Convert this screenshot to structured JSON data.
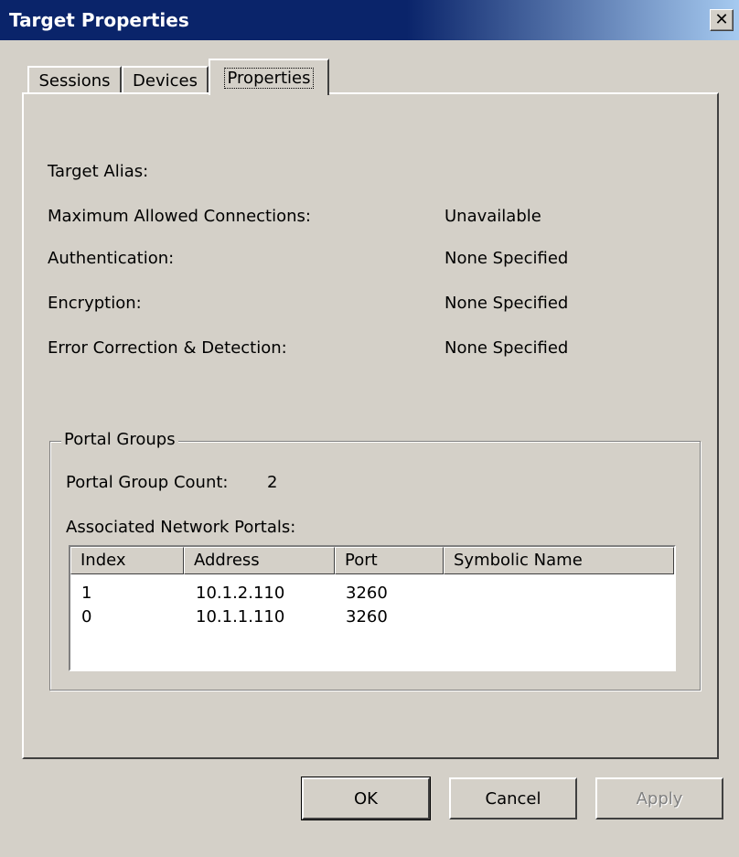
{
  "window": {
    "title": "Target Properties",
    "close_icon": "close-icon"
  },
  "tabs": [
    {
      "label": "Sessions",
      "active": false
    },
    {
      "label": "Devices",
      "active": false
    },
    {
      "label": "Properties",
      "active": true
    }
  ],
  "properties": [
    {
      "label": "Target Alias:",
      "value": ""
    },
    {
      "label": "Maximum Allowed Connections:",
      "value": "Unavailable"
    },
    {
      "label": "Authentication:",
      "value": "None Specified"
    },
    {
      "label": "Encryption:",
      "value": "None Specified"
    },
    {
      "label": "Error Correction & Detection:",
      "value": "None Specified"
    }
  ],
  "portal_groups": {
    "legend": "Portal Groups",
    "count_label": "Portal Group Count:",
    "count_value": "2",
    "associated_label": "Associated Network Portals:",
    "columns": [
      "Index",
      "Address",
      "Port",
      "Symbolic Name"
    ],
    "rows": [
      [
        "1",
        "10.1.2.110",
        "3260",
        ""
      ],
      [
        "0",
        "10.1.1.110",
        "3260",
        ""
      ]
    ]
  },
  "buttons": {
    "ok": "OK",
    "cancel": "Cancel",
    "apply": "Apply"
  }
}
